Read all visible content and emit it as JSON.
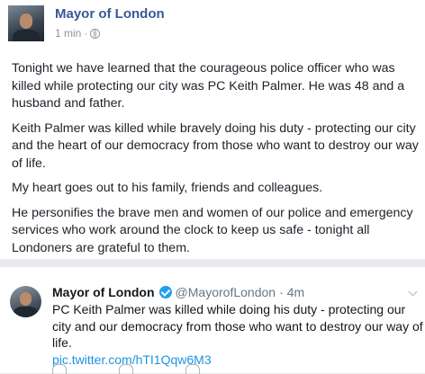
{
  "facebook_post": {
    "author": "Mayor of London",
    "time": "1 min",
    "separator": "·",
    "paragraphs": [
      "Tonight we have learned that the courageous police officer who was killed while protecting our city was PC Keith Palmer. He was 48 and a husband and father.",
      "Keith Palmer was killed while bravely doing his duty - protecting our city and the heart of our democracy from those who want to destroy our way of life.",
      "My heart goes out to his family, friends and colleagues.",
      "He personifies the brave men and women of our police and emergency services who work around the clock to keep us safe - tonight all Londoners are grateful to them."
    ],
    "icons": {
      "avatar": "profile-photo",
      "privacy": "globe-icon"
    }
  },
  "tweet": {
    "name": "Mayor of London",
    "handle": "@MayorofLondon",
    "separator": "·",
    "time": "4m",
    "text": "PC Keith Palmer was killed while doing his duty - protecting our city and our democracy from those who want to destroy our way of life.",
    "link": "pic.twitter.com/hTI1Qqw6M3",
    "icons": {
      "verified": "verified-badge-icon",
      "menu": "chevron-down-icon"
    },
    "colors": {
      "link": "#1b95e0",
      "verified": "#1da1f2"
    }
  },
  "colors": {
    "facebook_name": "#365899",
    "background": "#e9ebee"
  }
}
